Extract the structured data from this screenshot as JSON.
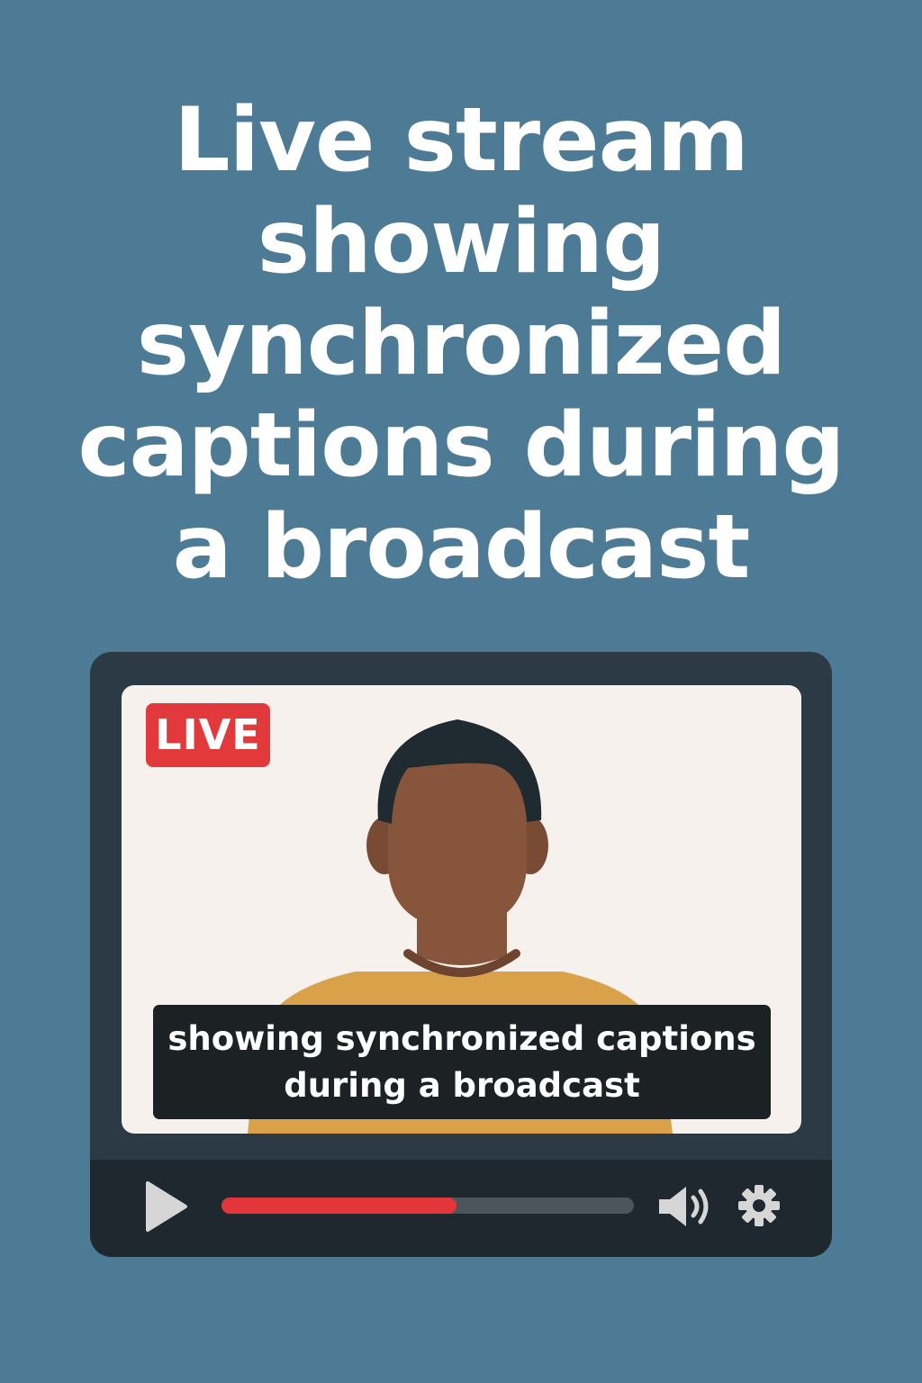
{
  "headline": {
    "lines": [
      "Live stream",
      "showing",
      "synchronized",
      "captions during",
      "a broadcast"
    ]
  },
  "player": {
    "live_badge": "LIVE",
    "captions": {
      "line1": "showing synchronized captions",
      "line2": "during a broadcast"
    },
    "progress": 0.57,
    "icons": {
      "play": "play-icon",
      "volume": "volume-icon",
      "settings": "gear-icon"
    }
  },
  "colors": {
    "background": "#4d7a94",
    "live_badge": "#e23a3c",
    "progress_fill": "#e3363b",
    "caption_bg": "#1c2124",
    "shirt": "#d9a14a",
    "skin": "#86553c",
    "hair": "#1f2a31"
  }
}
